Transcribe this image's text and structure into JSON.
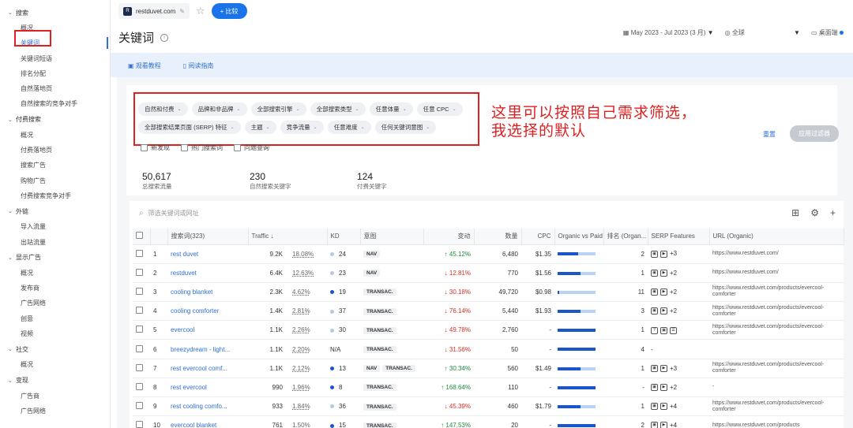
{
  "sidebar": {
    "sections": [
      {
        "title": "搜索",
        "items": [
          "概况",
          "关键词",
          "关键词短语",
          "排名分配",
          "自然落地页",
          "自然搜索的竞争对手"
        ]
      },
      {
        "title": "付费搜索",
        "items": [
          "概况",
          "付费落地页",
          "搜索广告",
          "购物广告",
          "付费搜索竞争对手"
        ]
      },
      {
        "title": "外链",
        "items": [
          "导入流量",
          "出站流量"
        ]
      },
      {
        "title": "显示广告",
        "items": [
          "概况",
          "发布商",
          "广告网络",
          "创意",
          "视频"
        ]
      },
      {
        "title": "社交",
        "items": [
          "概况"
        ]
      },
      {
        "title": "变现",
        "items": [
          "广告商",
          "广告网络"
        ]
      }
    ]
  },
  "topbar": {
    "favicon": "R",
    "domain": "restduvet.com",
    "compare_label": "+ 比较"
  },
  "header": {
    "title": "关键词",
    "date_range": "May 2023 - Jul 2023 (3 月)",
    "region": "全球",
    "device": "桌面端"
  },
  "guide": {
    "tutorial": "观看教程",
    "reading": "阅读指南"
  },
  "filters": {
    "chips": [
      "自然和付费",
      "品牌和非品牌",
      "全部搜索引擎",
      "全部搜索类型",
      "任意体量",
      "任意 CPC",
      "全部搜索结果页面 (SERP) 特征",
      "主题",
      "竞争流量",
      "任意难度",
      "任何关键词意图"
    ],
    "reset": "重置",
    "apply": "应用过滤器",
    "checks": [
      "新发现",
      "热门搜索词",
      "问题查询"
    ]
  },
  "annotation": {
    "line1": "这里可以按照自己需求筛选，",
    "line2": "我选择的默认"
  },
  "stats": [
    {
      "value": "50,617",
      "label": "总搜索流量"
    },
    {
      "value": "230",
      "label": "自然搜索关键字"
    },
    {
      "value": "124",
      "label": "付费关键字"
    }
  ],
  "search": {
    "placeholder": "筛选关键词或网址"
  },
  "table": {
    "headers": [
      "搜索词(323)",
      "Traffic ↓",
      "KD",
      "意图",
      "变动",
      "数量",
      "CPC",
      "Organic vs Paid",
      "排名 (Organ...",
      "SERP Features",
      "URL (Organic)"
    ],
    "rows": [
      {
        "n": "1",
        "kw": "rest duvet",
        "traffic": "9.2K",
        "pct": "18.08%",
        "kd": "24",
        "kdc": "#b9c9e3",
        "intent": [
          "NAV"
        ],
        "change": "↑ 45.12%",
        "dir": "up",
        "vol": "6,480",
        "cpc": "$1.35",
        "paid": 0.55,
        "rank": "2",
        "serp": "+3",
        "url": "https://www.restduvet.com/"
      },
      {
        "n": "2",
        "kw": "restduvet",
        "traffic": "6.4K",
        "pct": "12.63%",
        "kd": "23",
        "kdc": "#b9c9e3",
        "intent": [
          "NAV"
        ],
        "change": "↓ 12.81%",
        "dir": "down",
        "vol": "770",
        "cpc": "$1.56",
        "paid": 0.6,
        "rank": "1",
        "serp": "+2",
        "url": "https://www.restduvet.com/"
      },
      {
        "n": "3",
        "kw": "cooling blanket",
        "traffic": "2.3K",
        "pct": "4.62%",
        "kd": "19",
        "kdc": "#1a56c9",
        "intent": [
          "TRANSAC."
        ],
        "change": "↓ 30.18%",
        "dir": "down",
        "vol": "49,720",
        "cpc": "$0.98",
        "paid": 0.05,
        "rank": "11",
        "serp": "+2",
        "url": "https://www.restduvet.com/products/evercool-comforter"
      },
      {
        "n": "4",
        "kw": "cooling comforter",
        "traffic": "1.4K",
        "pct": "2.81%",
        "kd": "37",
        "kdc": "#b9c9e3",
        "intent": [
          "TRANSAC."
        ],
        "change": "↓ 76.14%",
        "dir": "down",
        "vol": "5,440",
        "cpc": "$1.93",
        "paid": 0.6,
        "rank": "3",
        "serp": "+2",
        "url": "https://www.restduvet.com/products/evercool-comforter"
      },
      {
        "n": "5",
        "kw": "evercool",
        "traffic": "1.1K",
        "pct": "2.26%",
        "kd": "30",
        "kdc": "#b9c9e3",
        "intent": [
          "TRANSAC."
        ],
        "change": "↓ 49.78%",
        "dir": "down",
        "vol": "2,760",
        "cpc": "-",
        "paid": 1.0,
        "rank": "1",
        "serp": "",
        "url": "https://www.restduvet.com/products/evercool-comforter"
      },
      {
        "n": "6",
        "kw": "breezydream - light...",
        "traffic": "1.1K",
        "pct": "2.20%",
        "kd": "N/A",
        "kdc": "",
        "intent": [
          "TRANSAC."
        ],
        "change": "↓ 31.56%",
        "dir": "down",
        "vol": "50",
        "cpc": "-",
        "paid": 1.0,
        "rank": "4",
        "serp": "-",
        "url": ""
      },
      {
        "n": "7",
        "kw": "rest evercool comf...",
        "traffic": "1.1K",
        "pct": "2.12%",
        "kd": "13",
        "kdc": "#1a56c9",
        "intent": [
          "NAV",
          "TRANSAC."
        ],
        "change": "↑ 30.34%",
        "dir": "up",
        "vol": "560",
        "cpc": "$1.49",
        "paid": 0.6,
        "rank": "1",
        "serp": "+3",
        "url": "https://www.restduvet.com/products/evercool-comforter"
      },
      {
        "n": "8",
        "kw": "rest evercool",
        "traffic": "990",
        "pct": "1.96%",
        "kd": "8",
        "kdc": "#1a56c9",
        "intent": [
          "TRANSAC."
        ],
        "change": "↑ 168.64%",
        "dir": "up",
        "vol": "110",
        "cpc": "-",
        "paid": 1.0,
        "rank": "-",
        "serp": "+2",
        "url": "-"
      },
      {
        "n": "9",
        "kw": "rest cooling comfo...",
        "traffic": "933",
        "pct": "1.84%",
        "kd": "36",
        "kdc": "#b9c9e3",
        "intent": [
          "TRANSAC."
        ],
        "change": "↓ 45.39%",
        "dir": "down",
        "vol": "460",
        "cpc": "$1.79",
        "paid": 0.6,
        "rank": "1",
        "serp": "+4",
        "url": "https://www.restduvet.com/products/evercool-comforter"
      },
      {
        "n": "10",
        "kw": "evercool blanket",
        "traffic": "761",
        "pct": "1.50%",
        "kd": "15",
        "kdc": "#1a56c9",
        "intent": [
          "TRANSAC."
        ],
        "change": "↑ 147.53%",
        "dir": "up",
        "vol": "20",
        "cpc": "-",
        "paid": 1.0,
        "rank": "2",
        "serp": "+4",
        "url": "https://www.restduvet.com/products"
      }
    ]
  }
}
